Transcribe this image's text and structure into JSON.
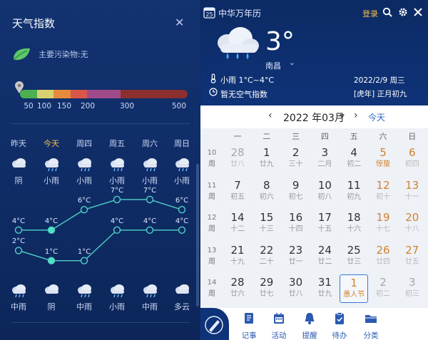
{
  "weather_panel": {
    "title": "天气指数",
    "pollutant": "主要污染物:无",
    "aqi_scale": {
      "labels": [
        "50",
        "100",
        "150",
        "200",
        "300",
        "500"
      ],
      "colors": [
        "#4caf50",
        "#d8d070",
        "#e68a3c",
        "#d9564a",
        "#a04a8a",
        "#8b2f2f"
      ]
    },
    "forecast": [
      {
        "day": "昨天",
        "top_condition": "阴",
        "top_icon": "cloudy-icon",
        "high": "4°C",
        "low": "2°C",
        "bottom_condition": "中雨",
        "bottom_icon": "rain-icon",
        "is_today": false
      },
      {
        "day": "今天",
        "top_condition": "小雨",
        "top_icon": "rain-icon",
        "high": "4°C",
        "low": "1°C",
        "bottom_condition": "阴",
        "bottom_icon": "cloudy-icon",
        "is_today": true
      },
      {
        "day": "周四",
        "top_condition": "小雨",
        "top_icon": "rain-icon",
        "high": "6°C",
        "low": "1°C",
        "bottom_condition": "中雨",
        "bottom_icon": "rain-icon",
        "is_today": false
      },
      {
        "day": "周五",
        "top_condition": "小雨",
        "top_icon": "rain-icon",
        "high": "7°C",
        "low": "4°C",
        "bottom_condition": "小雨",
        "bottom_icon": "rain-icon",
        "is_today": false
      },
      {
        "day": "周六",
        "top_condition": "小雨",
        "top_icon": "rain-icon",
        "high": "7°C",
        "low": "4°C",
        "bottom_condition": "中雨",
        "bottom_icon": "rain-icon",
        "is_today": false
      },
      {
        "day": "周日",
        "top_condition": "小雨",
        "top_icon": "rain-icon",
        "high": "6°C",
        "low": "4°C",
        "bottom_condition": "多云",
        "bottom_icon": "partly-cloudy-icon",
        "is_today": false
      }
    ],
    "high_values": [
      4,
      4,
      6,
      7,
      7,
      6
    ],
    "low_values": [
      2,
      1,
      1,
      4,
      4,
      4
    ]
  },
  "calendar": {
    "app_name": "中华万年历",
    "app_icon_day": "25",
    "login": "登录",
    "current": {
      "temp": "3°",
      "city": "南昌",
      "condition": "小雨  1°C~4°C",
      "air": "暂无空气指数",
      "date": "2022/2/9  周三",
      "lunar": "[虎年]  正月初九"
    },
    "month_label": "2022 年03月",
    "today_label": "今天",
    "weekdays": [
      "一",
      "二",
      "三",
      "四",
      "五",
      "六",
      "日"
    ],
    "weeks": [
      {
        "label": "10周",
        "days": [
          {
            "d": "28",
            "l": "廿八",
            "type": "other"
          },
          {
            "d": "1",
            "l": "廿九",
            "type": "normal"
          },
          {
            "d": "2",
            "l": "三十",
            "type": "normal"
          },
          {
            "d": "3",
            "l": "二月",
            "type": "normal"
          },
          {
            "d": "4",
            "l": "初二",
            "type": "normal"
          },
          {
            "d": "5",
            "l": "惊蛰",
            "type": "weekend-holiday"
          },
          {
            "d": "6",
            "l": "初四",
            "type": "weekend"
          }
        ]
      },
      {
        "label": "11周",
        "days": [
          {
            "d": "7",
            "l": "初五",
            "type": "normal"
          },
          {
            "d": "8",
            "l": "初六",
            "type": "normal"
          },
          {
            "d": "9",
            "l": "初七",
            "type": "normal"
          },
          {
            "d": "10",
            "l": "初八",
            "type": "normal"
          },
          {
            "d": "11",
            "l": "初九",
            "type": "normal"
          },
          {
            "d": "12",
            "l": "初十",
            "type": "weekend"
          },
          {
            "d": "13",
            "l": "十一",
            "type": "weekend"
          }
        ]
      },
      {
        "label": "12周",
        "days": [
          {
            "d": "14",
            "l": "十二",
            "type": "normal"
          },
          {
            "d": "15",
            "l": "十三",
            "type": "normal"
          },
          {
            "d": "16",
            "l": "十四",
            "type": "normal"
          },
          {
            "d": "17",
            "l": "十五",
            "type": "normal"
          },
          {
            "d": "18",
            "l": "十六",
            "type": "normal"
          },
          {
            "d": "19",
            "l": "十七",
            "type": "weekend"
          },
          {
            "d": "20",
            "l": "十八",
            "type": "weekend"
          }
        ]
      },
      {
        "label": "13周",
        "days": [
          {
            "d": "21",
            "l": "十九",
            "type": "normal"
          },
          {
            "d": "22",
            "l": "二十",
            "type": "normal"
          },
          {
            "d": "23",
            "l": "廿一",
            "type": "normal"
          },
          {
            "d": "24",
            "l": "廿二",
            "type": "normal"
          },
          {
            "d": "25",
            "l": "廿三",
            "type": "normal"
          },
          {
            "d": "26",
            "l": "廿四",
            "type": "weekend"
          },
          {
            "d": "27",
            "l": "廿五",
            "type": "weekend"
          }
        ]
      },
      {
        "label": "14周",
        "days": [
          {
            "d": "28",
            "l": "廿六",
            "type": "normal"
          },
          {
            "d": "29",
            "l": "廿七",
            "type": "normal"
          },
          {
            "d": "30",
            "l": "廿八",
            "type": "normal"
          },
          {
            "d": "31",
            "l": "廿九",
            "type": "normal"
          },
          {
            "d": "1",
            "l": "愚人节",
            "type": "selected"
          },
          {
            "d": "2",
            "l": "初二",
            "type": "other"
          },
          {
            "d": "3",
            "l": "初三",
            "type": "other"
          }
        ]
      }
    ],
    "tabs": [
      {
        "label": "记事",
        "icon": "notebook-icon"
      },
      {
        "label": "活动",
        "icon": "calendar-icon"
      },
      {
        "label": "提醒",
        "icon": "bell-icon"
      },
      {
        "label": "待办",
        "icon": "clipboard-icon"
      },
      {
        "label": "分类",
        "icon": "folder-icon"
      }
    ]
  }
}
